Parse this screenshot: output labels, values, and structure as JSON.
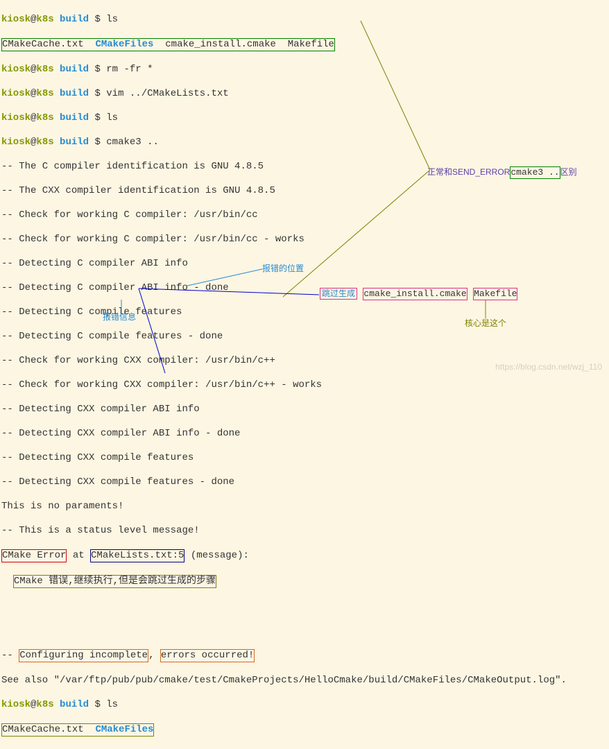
{
  "prompt": {
    "user": "kiosk",
    "at": "@",
    "host": "k8s",
    "path": "build",
    "sep": " $ "
  },
  "cmds": {
    "ls1": "ls",
    "rm": "rm -fr *",
    "vim": "vim ../CMakeLists.txt",
    "ls2": "ls",
    "cmake": "cmake3 ..",
    "ls3": "ls"
  },
  "files": {
    "cache": "CMakeCache.txt",
    "cmakefiles": "CMakeFiles",
    "install": "cmake_install.cmake",
    "makefile": "Makefile"
  },
  "out": {
    "l1": "-- The C compiler identification is GNU 4.8.5",
    "l2": "-- The CXX compiler identification is GNU 4.8.5",
    "l3": "-- Check for working C compiler: /usr/bin/cc",
    "l4": "-- Check for working C compiler: /usr/bin/cc - works",
    "l5": "-- Detecting C compiler ABI info",
    "l6": "-- Detecting C compiler ABI info - done",
    "l7": "-- Detecting C compile features",
    "l8": "-- Detecting C compile features - done",
    "l9": "-- Check for working CXX compiler: /usr/bin/c++",
    "l10": "-- Check for working CXX compiler: /usr/bin/c++ - works",
    "l11": "-- Detecting CXX compiler ABI info",
    "l12": "-- Detecting CXX compiler ABI info - done",
    "l13": "-- Detecting CXX compile features",
    "l14": "-- Detecting CXX compile features - done",
    "l15": "This is no paraments!",
    "l16": "-- This is a status level message!",
    "err_pre": "CMake Error",
    "err_at": " at ",
    "err_loc": "CMakeLists.txt:5",
    "err_post": " (message):",
    "err_msg": "CMake 错误,继续执行,但是会跳过生成的步骤",
    "pad_space": "  ",
    "cfg_pre": "-- ",
    "cfg_a": "Configuring incomplete",
    "cfg_sep": ", ",
    "cfg_b": "errors occurred!",
    "seealso": "See also \"/var/ftp/pub/pub/cmake/test/CmakeProjects/HelloCmake/build/CMakeFiles/CMakeOutput.log\"."
  },
  "labels": {
    "error_pos": "报错的位置",
    "error_info": "报错信息",
    "skip_gen": "跳过生成",
    "normal_err": "正常和SEND_ERROR",
    "cmake3": "cmake3 ..",
    "diff": "区别",
    "core": "核心是这个"
  },
  "watermark": "https://blog.csdn.net/wzj_110"
}
